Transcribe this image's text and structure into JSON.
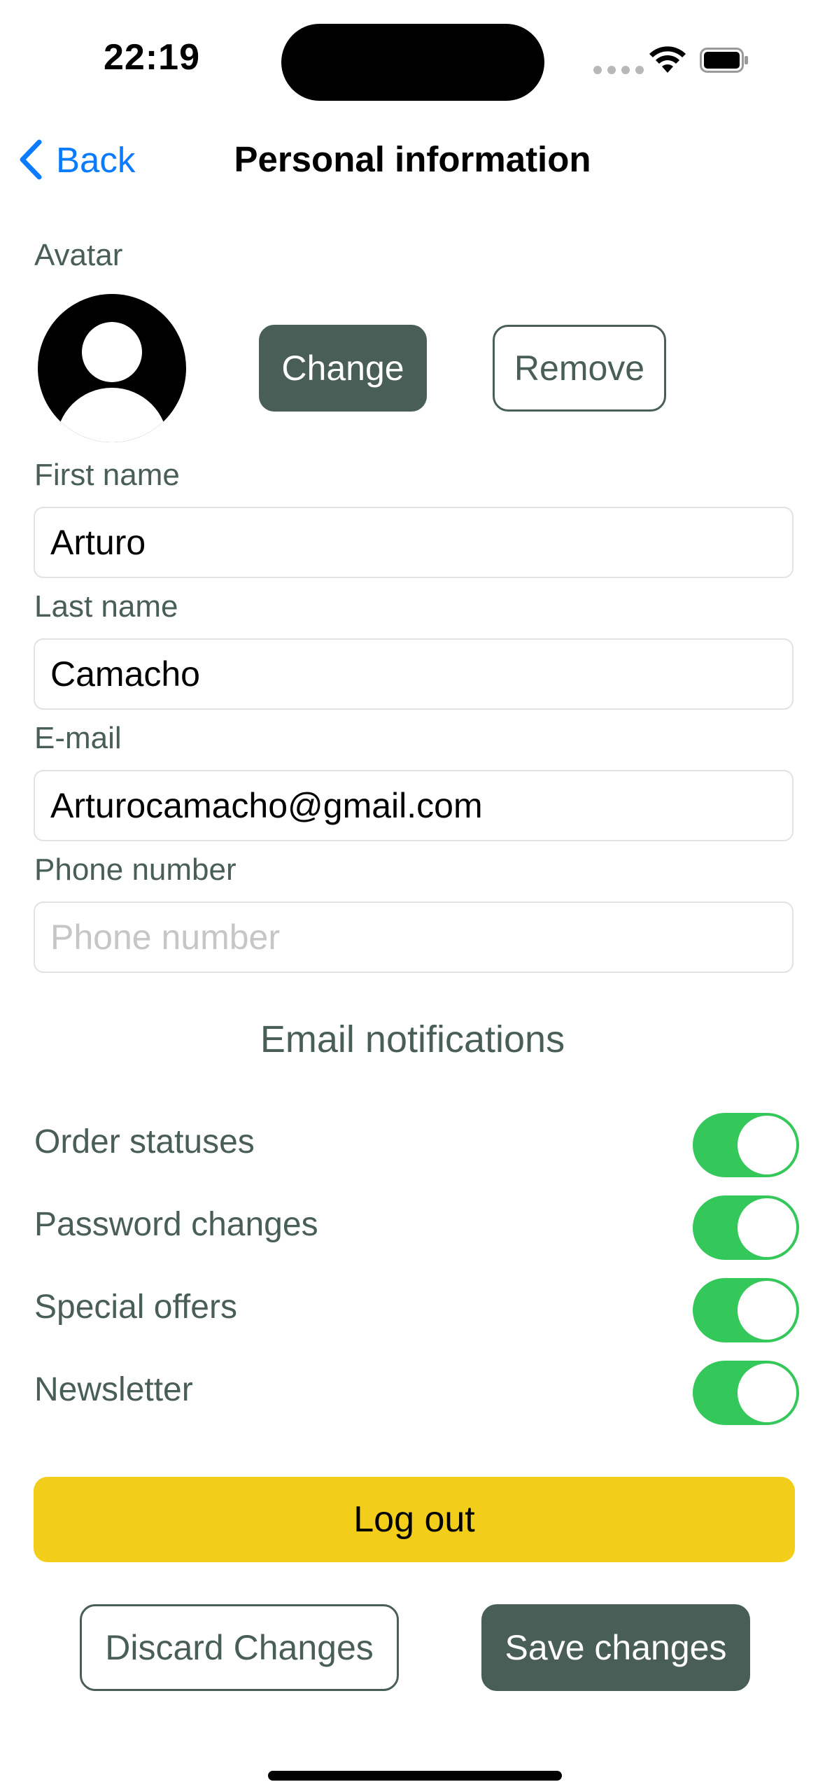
{
  "status_bar": {
    "time": "22:19",
    "icons": [
      "cellular-signal-icon",
      "wifi-icon",
      "battery-icon"
    ]
  },
  "nav": {
    "back_label": "Back",
    "title": "Personal information"
  },
  "avatar": {
    "label": "Avatar",
    "change_label": "Change",
    "remove_label": "Remove"
  },
  "form": {
    "first_name": {
      "label": "First name",
      "value": "Arturo",
      "placeholder": ""
    },
    "last_name": {
      "label": "Last name",
      "value": "Camacho",
      "placeholder": ""
    },
    "email": {
      "label": "E-mail",
      "value": "Arturocamacho@gmail.com",
      "placeholder": ""
    },
    "phone": {
      "label": "Phone number",
      "value": "",
      "placeholder": "Phone number"
    }
  },
  "notifications": {
    "title": "Email notifications",
    "items": [
      {
        "label": "Order statuses",
        "enabled": true
      },
      {
        "label": "Password changes",
        "enabled": true
      },
      {
        "label": "Special offers",
        "enabled": true
      },
      {
        "label": "Newsletter",
        "enabled": true
      }
    ]
  },
  "actions": {
    "logout_label": "Log out",
    "discard_label": "Discard Changes",
    "save_label": "Save changes"
  },
  "colors": {
    "accent": "#4a5e58",
    "link": "#0a7bff",
    "toggle_on": "#34c759",
    "logout": "#f2ce1a"
  }
}
